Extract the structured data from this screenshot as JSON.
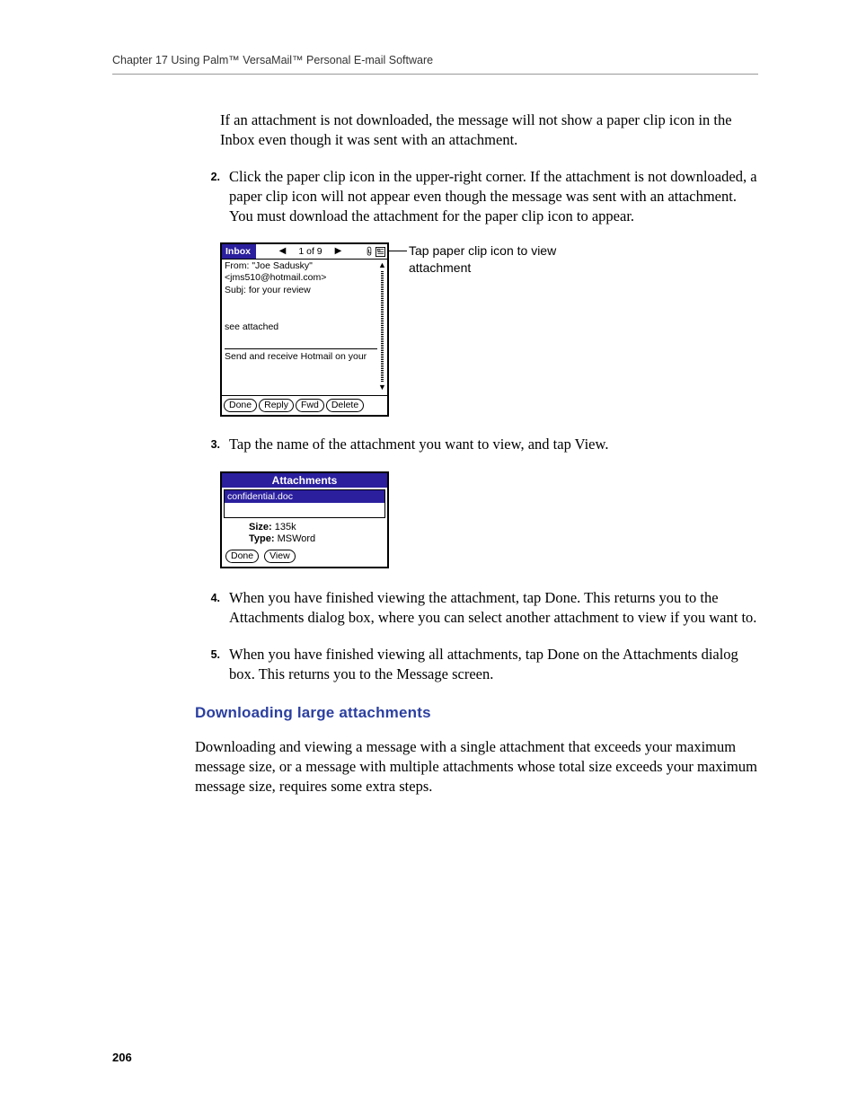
{
  "header": {
    "chapter_line": "Chapter 17    Using Palm™ VersaMail™ Personal E-mail Software"
  },
  "intro_para": "If an attachment is not downloaded, the message will not show a paper clip icon in the Inbox even though it was sent with an attachment.",
  "steps": {
    "s2_num": "2.",
    "s2_text": "Click the paper clip icon in the upper-right corner. If the attachment is not downloaded, a paper clip icon will not appear even though the message was sent with an attachment. You must download the attachment for the paper clip icon to appear.",
    "s3_num": "3.",
    "s3_text": "Tap the name of the attachment you want to view, and tap View.",
    "s4_num": "4.",
    "s4_text": "When you have finished viewing the attachment, tap Done. This returns you to the Attachments dialog box, where you can select another attachment to view if you want to.",
    "s5_num": "5.",
    "s5_text": "When you have finished viewing all attachments, tap Done on the Attachments dialog box. This returns you to the Message screen."
  },
  "msg_screenshot": {
    "inbox_label": "Inbox",
    "counter": "1 of 9",
    "from_line": "From: \"Joe Sadusky\"",
    "from_email": "<jms510@hotmail.com>",
    "subj_line": "Subj:  for your review",
    "body1": "see attached",
    "body2": "Send and receive Hotmail on your",
    "btn_done": "Done",
    "btn_reply": "Reply",
    "btn_fwd": "Fwd",
    "btn_delete": "Delete"
  },
  "callout": {
    "line1": "Tap paper clip icon to view",
    "line2": "attachment"
  },
  "attach_screenshot": {
    "title": "Attachments",
    "item": "confidential.doc",
    "size_label": "Size:",
    "size_value": " 135k",
    "type_label": "Type:",
    "type_value": " MSWord",
    "btn_done": "Done",
    "btn_view": "View"
  },
  "subheading": "Downloading large attachments",
  "sub_para": "Downloading and viewing a message with a single attachment that exceeds your maximum message size, or a message with multiple attachments whose total size exceeds your maximum message size, requires some extra steps.",
  "page_number": "206"
}
